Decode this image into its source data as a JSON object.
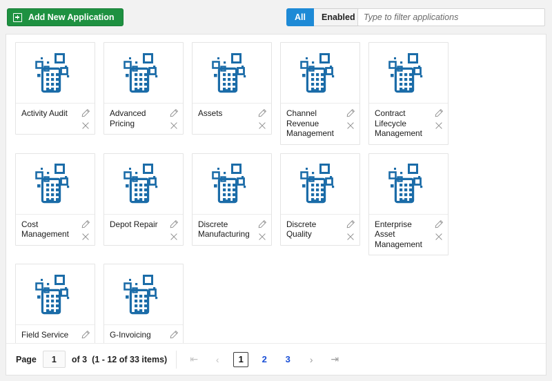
{
  "toolbar": {
    "add_button_label": "Add New Application",
    "add_button_icon": "plus-square-icon",
    "add_button_color": "#1e9141",
    "segments": [
      {
        "label": "All",
        "active": true
      },
      {
        "label": "Enabled",
        "active": false
      }
    ],
    "active_segment_color": "#1e8ad6",
    "filter": {
      "value": "",
      "placeholder": "Type to filter applications"
    }
  },
  "grid": {
    "card_icon_name": "application-tablet-icon",
    "icon_color": "#1b6ca8",
    "edit_icon_name": "pencil-icon",
    "remove_icon_name": "close-x-icon",
    "rows": [
      [
        {
          "name": "Activity Audit"
        },
        {
          "name": "Advanced Pricing"
        },
        {
          "name": "Assets"
        },
        {
          "name": "Channel Revenue Management"
        },
        {
          "name": "Contract Lifecycle Management"
        }
      ],
      [
        {
          "name": "Cost Management"
        },
        {
          "name": "Depot Repair"
        },
        {
          "name": "Discrete Manufacturing"
        },
        {
          "name": "Discrete Quality"
        },
        {
          "name": "Enterprise Asset Management"
        }
      ],
      [
        {
          "name": "Field Service"
        },
        {
          "name": "G-Invoicing"
        }
      ]
    ]
  },
  "footer": {
    "page_label": "Page",
    "page_value": "1",
    "of_text": "of 3",
    "item_range": "(1 - 12 of 33 items)",
    "pager": {
      "first_icon": "first-page-icon",
      "prev_icon": "previous-page-icon",
      "next_icon": "next-page-icon",
      "last_icon": "last-page-icon",
      "pages": [
        "1",
        "2",
        "3"
      ],
      "current_page": "1",
      "link_color": "#1a4fd6"
    }
  }
}
